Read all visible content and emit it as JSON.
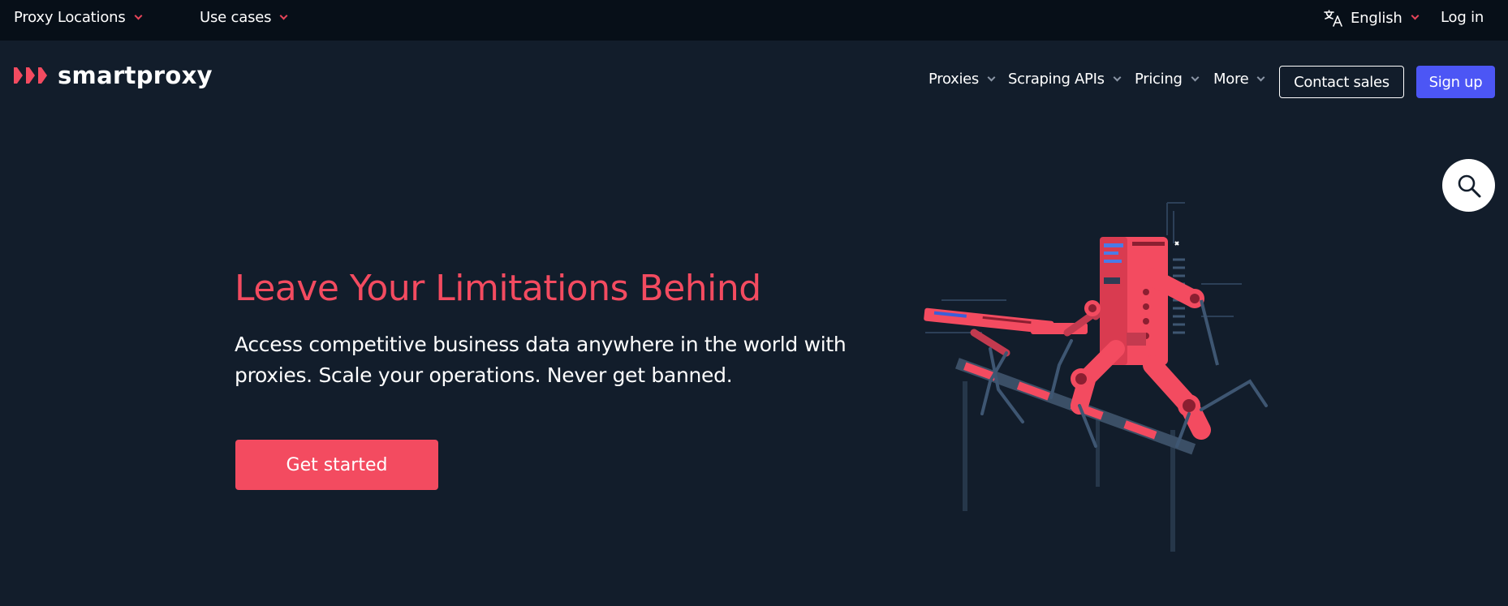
{
  "topbar": {
    "proxy_locations": "Proxy Locations",
    "use_cases": "Use cases",
    "language": "English",
    "login": "Log in"
  },
  "brand": {
    "name": "smartproxy",
    "accent": "#f34b60"
  },
  "nav": {
    "items": [
      {
        "label": "Proxies"
      },
      {
        "label": "Scraping APIs"
      },
      {
        "label": "Pricing"
      },
      {
        "label": "More"
      }
    ],
    "contact_sales": "Contact sales",
    "sign_up": "Sign up",
    "sign_up_color": "#4c56f5"
  },
  "hero": {
    "title": "Leave Your Limitations Behind",
    "subtitle": "Access competitive business data anywhere in the world with proxies. Scale your operations. Never get banned.",
    "cta": "Get started"
  },
  "icons": {
    "search": "search-icon",
    "translate": "translate-icon",
    "chevron": "chevron-down-icon"
  }
}
